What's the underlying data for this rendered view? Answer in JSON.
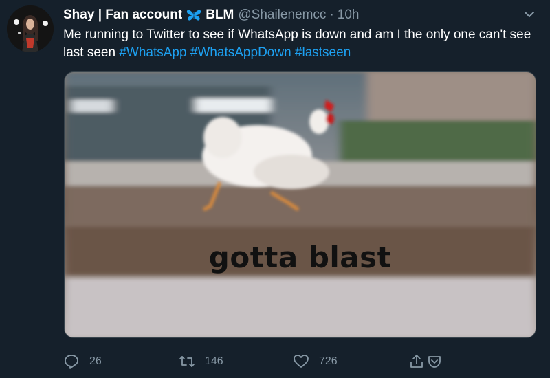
{
  "tweet": {
    "display_name": "Shay | Fan account",
    "badge_text": "BLM",
    "handle": "@Shailenemcc",
    "separator": "·",
    "time": "10h",
    "text_main": "Me running to Twitter to see if WhatsApp is down and am I the only one can't see last seen ",
    "hashtags": [
      "#WhatsApp",
      "#WhatsAppDown",
      "#lastseen"
    ],
    "media_caption": "gotta blast",
    "reply_count": "26",
    "retweet_count": "146",
    "like_count": "726"
  },
  "icons": {
    "badge": "butterfly-icon",
    "more": "chevron-down-icon",
    "reply": "reply-icon",
    "retweet": "retweet-icon",
    "like": "heart-icon",
    "share": "share-icon"
  },
  "colors": {
    "background": "#15202b",
    "hashtag": "#1da1f2",
    "muted": "#8899a6",
    "badge": "#1da1f2"
  }
}
